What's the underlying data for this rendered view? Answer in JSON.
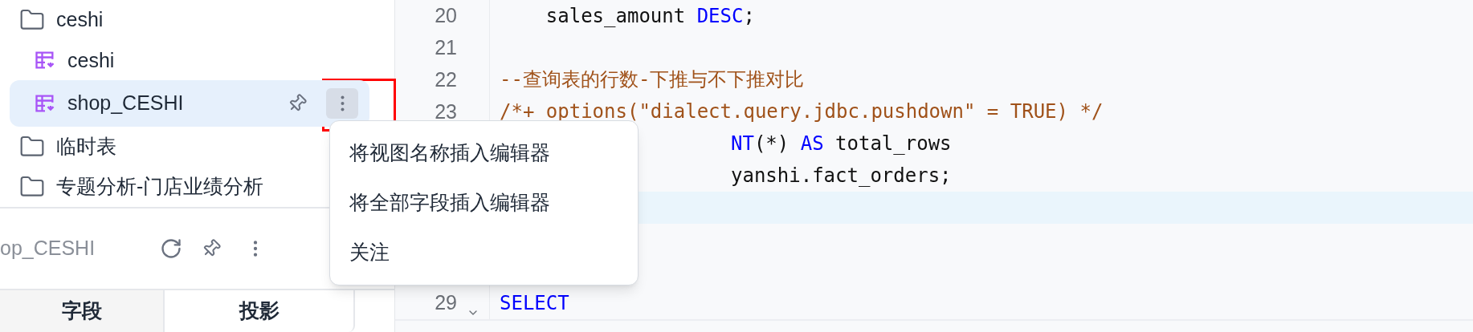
{
  "tree": {
    "items": [
      {
        "label": "ceshi",
        "kind": "folder",
        "selected": false,
        "children": [
          {
            "label": "ceshi",
            "kind": "view",
            "selected": false
          },
          {
            "label": "shop_CESHI",
            "kind": "view",
            "selected": true
          }
        ]
      },
      {
        "label": "临时表",
        "kind": "folder",
        "selected": false
      },
      {
        "label": "专题分析-门店业绩分析",
        "kind": "folder",
        "selected": false
      }
    ]
  },
  "details": {
    "title": "op_CESHI",
    "tabs": [
      {
        "label": "字段",
        "selected": false
      },
      {
        "label": "投影",
        "selected": true
      }
    ]
  },
  "context_menu": {
    "items": [
      "将视图名称插入编辑器",
      "将全部字段插入编辑器",
      "关注"
    ]
  },
  "editor": {
    "lines": [
      {
        "number": "20",
        "kind": "full",
        "tokens": [
          {
            "text": "    sales_amount ",
            "kind": "plain"
          },
          {
            "text": "DESC",
            "kind": "keyword"
          },
          {
            "text": ";",
            "kind": "plain"
          }
        ]
      },
      {
        "number": "21",
        "kind": "full"
      },
      {
        "number": "22",
        "kind": "full",
        "tokens": [
          {
            "text": "--查询表的行数-下推与不下推对比",
            "kind": "comment"
          }
        ]
      },
      {
        "number": "23",
        "kind": "full",
        "tokens": [
          {
            "text": "/*+ options(\"dialect.query.jdbc.pushdown\" = TRUE) */",
            "kind": "comment"
          }
        ]
      },
      {
        "kind": "covered",
        "tokens": [
          {
            "text": "NT",
            "kind": "keyword"
          },
          {
            "text": "(*) ",
            "kind": "plain"
          },
          {
            "text": "AS",
            "kind": "keyword"
          },
          {
            "text": " total_rows",
            "kind": "plain"
          }
        ]
      },
      {
        "kind": "covered",
        "tokens": [
          {
            "text": "yanshi.fact_orders;",
            "kind": "plain"
          }
        ]
      },
      {
        "kind": "covered",
        "current": true
      },
      {
        "kind": "covered"
      },
      {
        "kind": "covered"
      },
      {
        "number": "29",
        "kind": "full",
        "foldable": true,
        "tokens": [
          {
            "text": "SELECT",
            "kind": "keyword"
          }
        ]
      }
    ]
  }
}
